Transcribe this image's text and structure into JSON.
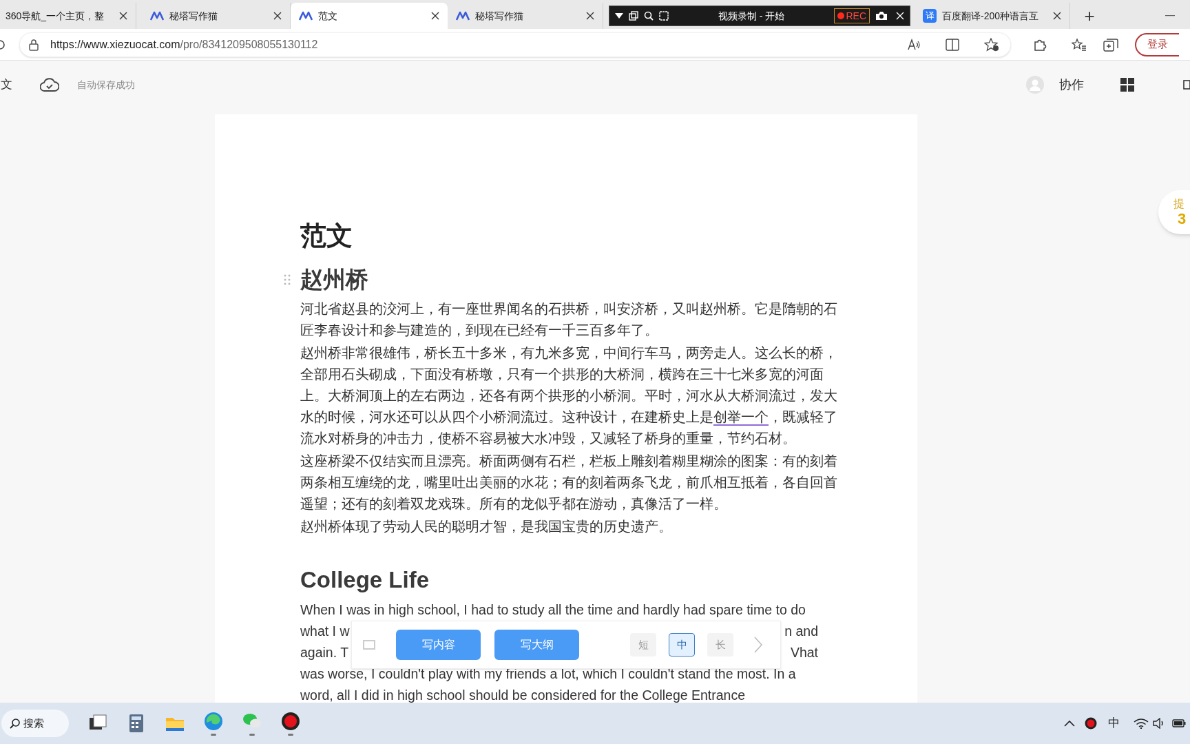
{
  "browser": {
    "tabs": [
      {
        "label": "360导航_一个主页，整",
        "selected": false,
        "kind": "plain"
      },
      {
        "label": "秘塔写作猫",
        "selected": false,
        "kind": "app"
      },
      {
        "label": "范文",
        "selected": true,
        "kind": "app"
      },
      {
        "label": "秘塔写作猫",
        "selected": false,
        "kind": "app"
      }
    ],
    "recorder": {
      "title": "视频录制 - 开始",
      "rec": "REC"
    },
    "tabs_after": [
      {
        "label": "百度翻译-200种语言互",
        "selected": false,
        "kind": "translator",
        "badge": "译"
      }
    ],
    "new_tab": "+",
    "url_host": "https://www.xiezuocat.com",
    "url_path": "/pro/8341209508055130112",
    "login": "登录"
  },
  "app_bar": {
    "left_cut": "文",
    "save_status": "自动保存成功",
    "collab": "协作"
  },
  "document": {
    "title": "范文",
    "sections": [
      {
        "heading": "赵州桥",
        "paragraphs": [
          {
            "text": "河北省赵县的洨河上，有一座世界闻名的石拱桥，叫安济桥，又叫赵州桥。它是隋朝的石匠李春设计和参与建造的，到现在已经有一千三百多年了。"
          },
          {
            "text": "赵州桥非常很雄伟，桥长五十多米，有九米多宽，中间行车马，两旁走人。这么长的桥，全部用石头砌成，下面没有桥墩，只有一个拱形的大桥洞，横跨在三十七米多宽的河面上。大桥洞顶上的左右两边，还各有两个拱形的小桥洞。平时，河水从大桥洞流过，发大水的时候，河水还可以从四个小桥洞流过。这种设计，在建桥史上是",
            "flagged": "创举一个",
            "after": "，既减轻了流水对桥身的冲击力，使桥不容易被大水冲毁，又减轻了桥身的重量，节约石材。"
          },
          {
            "text": "这座桥梁不仅结实而且漂亮。桥面两侧有石栏，栏板上雕刻着糊里糊涂的图案：有的刻着两条相互缠绕的龙，嘴里吐出美丽的水花；有的刻着两条飞龙，前爪相互抵着，各自回首遥望；还有的刻着双龙戏珠。所有的龙似乎都在游动，真像活了一样。"
          },
          {
            "text": "赵州桥体现了劳动人民的聪明才智，是我国宝贵的历史遗产。"
          }
        ]
      },
      {
        "heading": "College Life",
        "lines": [
          {
            "left": "When I was in high school, I had to study all the time and hardly had spare time to do"
          },
          {
            "left": "what I w",
            "right": "n and"
          },
          {
            "left": "again. T",
            "right": "Vhat"
          },
          {
            "left": "was worse, I couldn't play with my friends a lot, which I couldn't stand the most. In a"
          },
          {
            "left": "word, all I did in high school should be considered for the College Entrance"
          }
        ]
      }
    ]
  },
  "write_toolbar": {
    "checked": false,
    "actions": [
      "写内容",
      "写大纲"
    ],
    "lengths": [
      {
        "label": "短",
        "selected": false
      },
      {
        "label": "中",
        "selected": true
      },
      {
        "label": "长",
        "selected": false
      }
    ]
  },
  "hint_badge": {
    "label": "提",
    "count": "3"
  },
  "taskbar": {
    "search": "搜索",
    "ime": "中"
  }
}
